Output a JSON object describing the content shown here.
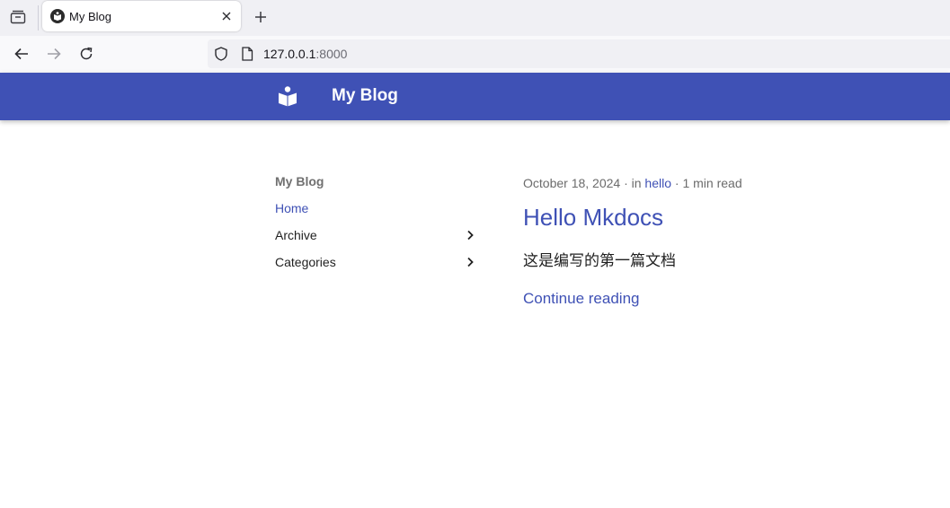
{
  "browser": {
    "tab_title": "My Blog",
    "url_host": "127.0.0.1",
    "url_port": ":8000"
  },
  "header": {
    "site_title": "My Blog",
    "background_color": "#3f51b5"
  },
  "sidebar": {
    "title": "My Blog",
    "items": [
      {
        "label": "Home",
        "active": true
      },
      {
        "label": "Archive",
        "expandable": true
      },
      {
        "label": "Categories",
        "expandable": true
      }
    ]
  },
  "post": {
    "date": "October 18, 2024",
    "sep1": " · in ",
    "category": "hello",
    "sep2": " · ",
    "read_time": "1 min read",
    "title": "Hello Mkdocs",
    "excerpt": "这是编写的第一篇文档",
    "continue_label": "Continue reading"
  },
  "icons": {
    "tab_list": "tab-list-icon",
    "close": "close-icon",
    "new_tab": "plus-icon",
    "back": "arrow-left-icon",
    "forward": "arrow-right-icon",
    "reload": "reload-icon",
    "shield": "shield-icon",
    "page": "page-icon",
    "logo": "book-reader-icon",
    "chevron": "chevron-right-icon"
  }
}
